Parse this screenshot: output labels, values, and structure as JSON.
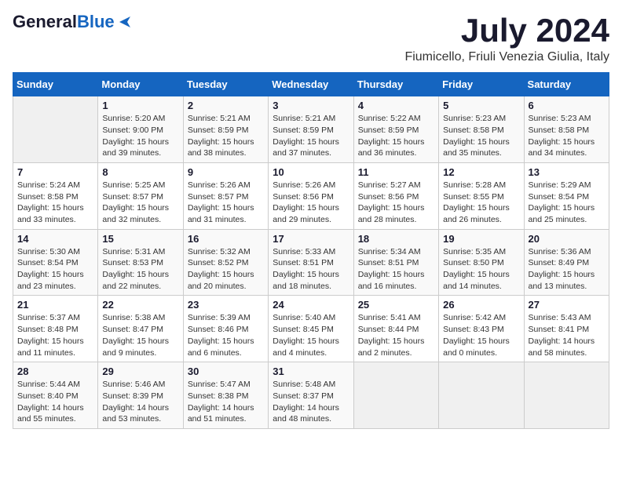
{
  "logo": {
    "general": "General",
    "blue": "Blue"
  },
  "title": {
    "month_year": "July 2024",
    "location": "Fiumicello, Friuli Venezia Giulia, Italy"
  },
  "calendar": {
    "headers": [
      "Sunday",
      "Monday",
      "Tuesday",
      "Wednesday",
      "Thursday",
      "Friday",
      "Saturday"
    ],
    "rows": [
      [
        {
          "day": "",
          "info": ""
        },
        {
          "day": "1",
          "info": "Sunrise: 5:20 AM\nSunset: 9:00 PM\nDaylight: 15 hours\nand 39 minutes."
        },
        {
          "day": "2",
          "info": "Sunrise: 5:21 AM\nSunset: 8:59 PM\nDaylight: 15 hours\nand 38 minutes."
        },
        {
          "day": "3",
          "info": "Sunrise: 5:21 AM\nSunset: 8:59 PM\nDaylight: 15 hours\nand 37 minutes."
        },
        {
          "day": "4",
          "info": "Sunrise: 5:22 AM\nSunset: 8:59 PM\nDaylight: 15 hours\nand 36 minutes."
        },
        {
          "day": "5",
          "info": "Sunrise: 5:23 AM\nSunset: 8:58 PM\nDaylight: 15 hours\nand 35 minutes."
        },
        {
          "day": "6",
          "info": "Sunrise: 5:23 AM\nSunset: 8:58 PM\nDaylight: 15 hours\nand 34 minutes."
        }
      ],
      [
        {
          "day": "7",
          "info": "Sunrise: 5:24 AM\nSunset: 8:58 PM\nDaylight: 15 hours\nand 33 minutes."
        },
        {
          "day": "8",
          "info": "Sunrise: 5:25 AM\nSunset: 8:57 PM\nDaylight: 15 hours\nand 32 minutes."
        },
        {
          "day": "9",
          "info": "Sunrise: 5:26 AM\nSunset: 8:57 PM\nDaylight: 15 hours\nand 31 minutes."
        },
        {
          "day": "10",
          "info": "Sunrise: 5:26 AM\nSunset: 8:56 PM\nDaylight: 15 hours\nand 29 minutes."
        },
        {
          "day": "11",
          "info": "Sunrise: 5:27 AM\nSunset: 8:56 PM\nDaylight: 15 hours\nand 28 minutes."
        },
        {
          "day": "12",
          "info": "Sunrise: 5:28 AM\nSunset: 8:55 PM\nDaylight: 15 hours\nand 26 minutes."
        },
        {
          "day": "13",
          "info": "Sunrise: 5:29 AM\nSunset: 8:54 PM\nDaylight: 15 hours\nand 25 minutes."
        }
      ],
      [
        {
          "day": "14",
          "info": "Sunrise: 5:30 AM\nSunset: 8:54 PM\nDaylight: 15 hours\nand 23 minutes."
        },
        {
          "day": "15",
          "info": "Sunrise: 5:31 AM\nSunset: 8:53 PM\nDaylight: 15 hours\nand 22 minutes."
        },
        {
          "day": "16",
          "info": "Sunrise: 5:32 AM\nSunset: 8:52 PM\nDaylight: 15 hours\nand 20 minutes."
        },
        {
          "day": "17",
          "info": "Sunrise: 5:33 AM\nSunset: 8:51 PM\nDaylight: 15 hours\nand 18 minutes."
        },
        {
          "day": "18",
          "info": "Sunrise: 5:34 AM\nSunset: 8:51 PM\nDaylight: 15 hours\nand 16 minutes."
        },
        {
          "day": "19",
          "info": "Sunrise: 5:35 AM\nSunset: 8:50 PM\nDaylight: 15 hours\nand 14 minutes."
        },
        {
          "day": "20",
          "info": "Sunrise: 5:36 AM\nSunset: 8:49 PM\nDaylight: 15 hours\nand 13 minutes."
        }
      ],
      [
        {
          "day": "21",
          "info": "Sunrise: 5:37 AM\nSunset: 8:48 PM\nDaylight: 15 hours\nand 11 minutes."
        },
        {
          "day": "22",
          "info": "Sunrise: 5:38 AM\nSunset: 8:47 PM\nDaylight: 15 hours\nand 9 minutes."
        },
        {
          "day": "23",
          "info": "Sunrise: 5:39 AM\nSunset: 8:46 PM\nDaylight: 15 hours\nand 6 minutes."
        },
        {
          "day": "24",
          "info": "Sunrise: 5:40 AM\nSunset: 8:45 PM\nDaylight: 15 hours\nand 4 minutes."
        },
        {
          "day": "25",
          "info": "Sunrise: 5:41 AM\nSunset: 8:44 PM\nDaylight: 15 hours\nand 2 minutes."
        },
        {
          "day": "26",
          "info": "Sunrise: 5:42 AM\nSunset: 8:43 PM\nDaylight: 15 hours\nand 0 minutes."
        },
        {
          "day": "27",
          "info": "Sunrise: 5:43 AM\nSunset: 8:41 PM\nDaylight: 14 hours\nand 58 minutes."
        }
      ],
      [
        {
          "day": "28",
          "info": "Sunrise: 5:44 AM\nSunset: 8:40 PM\nDaylight: 14 hours\nand 55 minutes."
        },
        {
          "day": "29",
          "info": "Sunrise: 5:46 AM\nSunset: 8:39 PM\nDaylight: 14 hours\nand 53 minutes."
        },
        {
          "day": "30",
          "info": "Sunrise: 5:47 AM\nSunset: 8:38 PM\nDaylight: 14 hours\nand 51 minutes."
        },
        {
          "day": "31",
          "info": "Sunrise: 5:48 AM\nSunset: 8:37 PM\nDaylight: 14 hours\nand 48 minutes."
        },
        {
          "day": "",
          "info": ""
        },
        {
          "day": "",
          "info": ""
        },
        {
          "day": "",
          "info": ""
        }
      ]
    ]
  }
}
